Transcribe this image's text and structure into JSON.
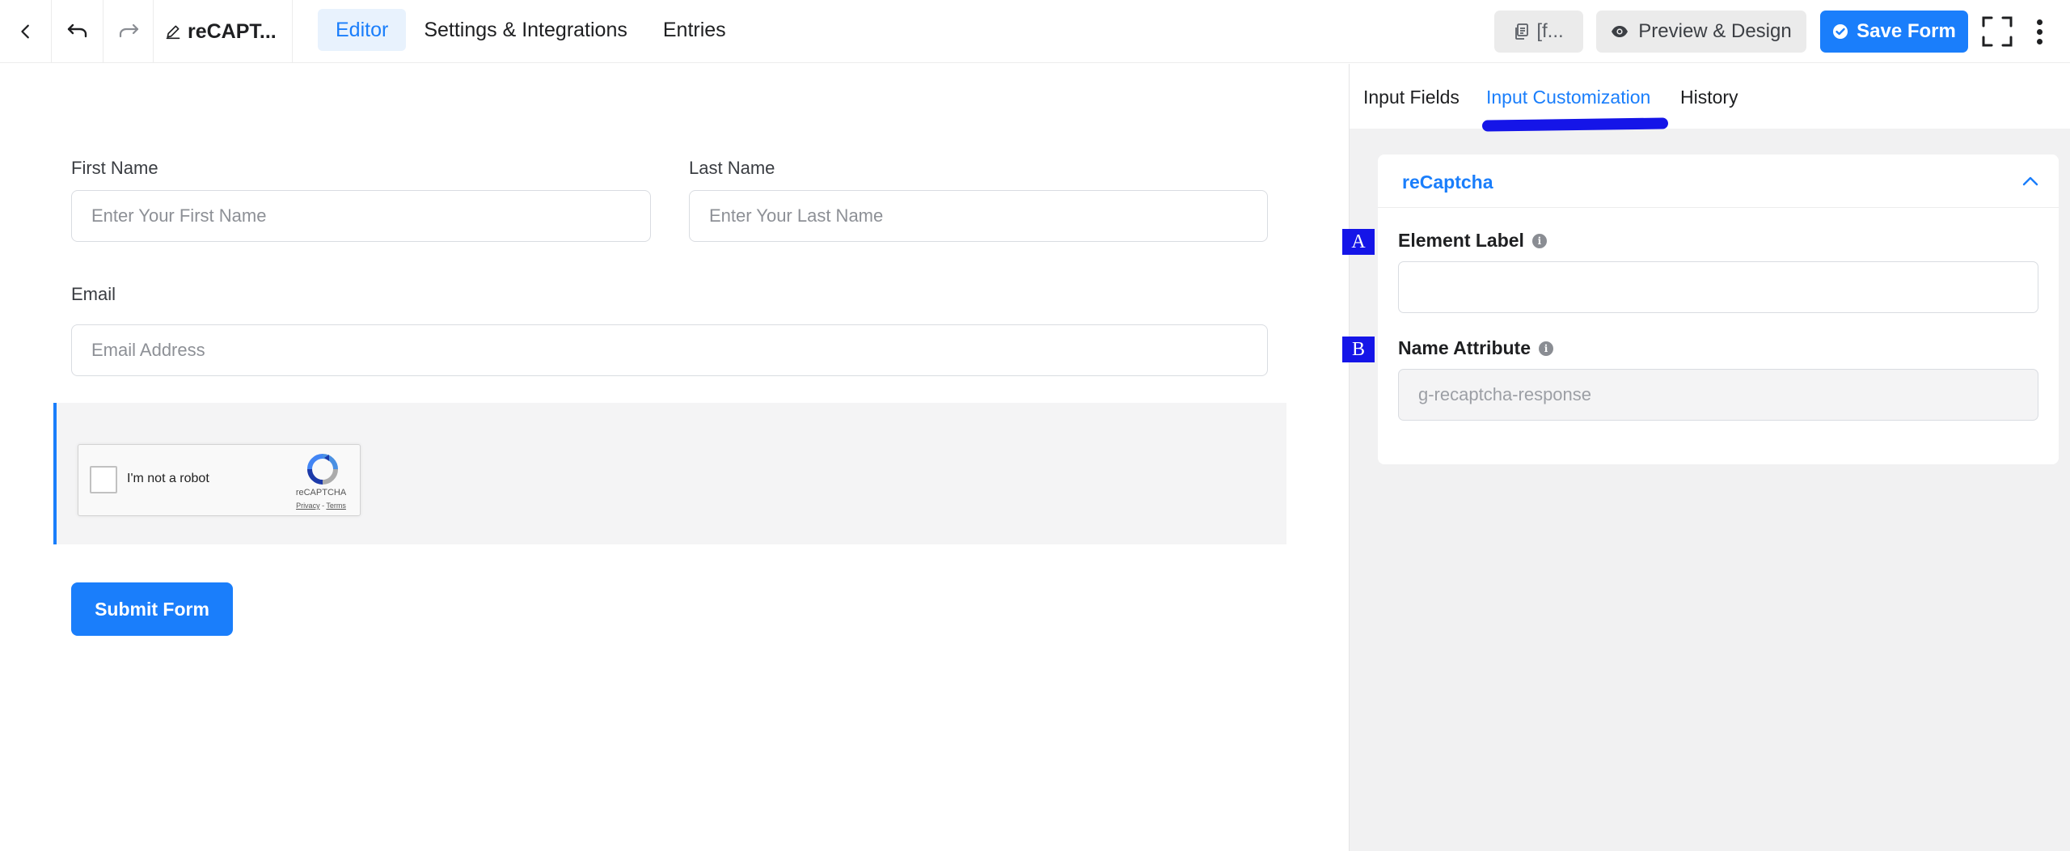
{
  "topbar": {
    "form_title": "reCAPT...",
    "tabs": [
      {
        "label": "Editor",
        "active": true
      },
      {
        "label": "Settings & Integrations",
        "active": false
      },
      {
        "label": "Entries",
        "active": false
      }
    ],
    "shortcode_label": "[f...",
    "preview_label": "Preview & Design",
    "save_label": "Save Form",
    "accent_color": "#1a7efb"
  },
  "form": {
    "first_name": {
      "label": "First Name",
      "placeholder": "Enter Your First Name"
    },
    "last_name": {
      "label": "Last Name",
      "placeholder": "Enter Your Last Name"
    },
    "email": {
      "label": "Email",
      "placeholder": "Email Address"
    },
    "recaptcha": {
      "checkbox_text": "I'm not a robot",
      "brand": "reCAPTCHA",
      "privacy": "Privacy",
      "separator": " - ",
      "terms": "Terms"
    },
    "submit_label": "Submit Form"
  },
  "panel": {
    "tabs": [
      {
        "label": "Input Fields",
        "active": false
      },
      {
        "label": "Input Customization",
        "active": true
      },
      {
        "label": "History",
        "active": false
      }
    ],
    "section_title": "reCaptcha",
    "element_label": {
      "label": "Element Label",
      "value": ""
    },
    "name_attribute": {
      "label": "Name Attribute",
      "value": "g-recaptcha-response"
    },
    "markers": [
      "A",
      "B"
    ]
  }
}
